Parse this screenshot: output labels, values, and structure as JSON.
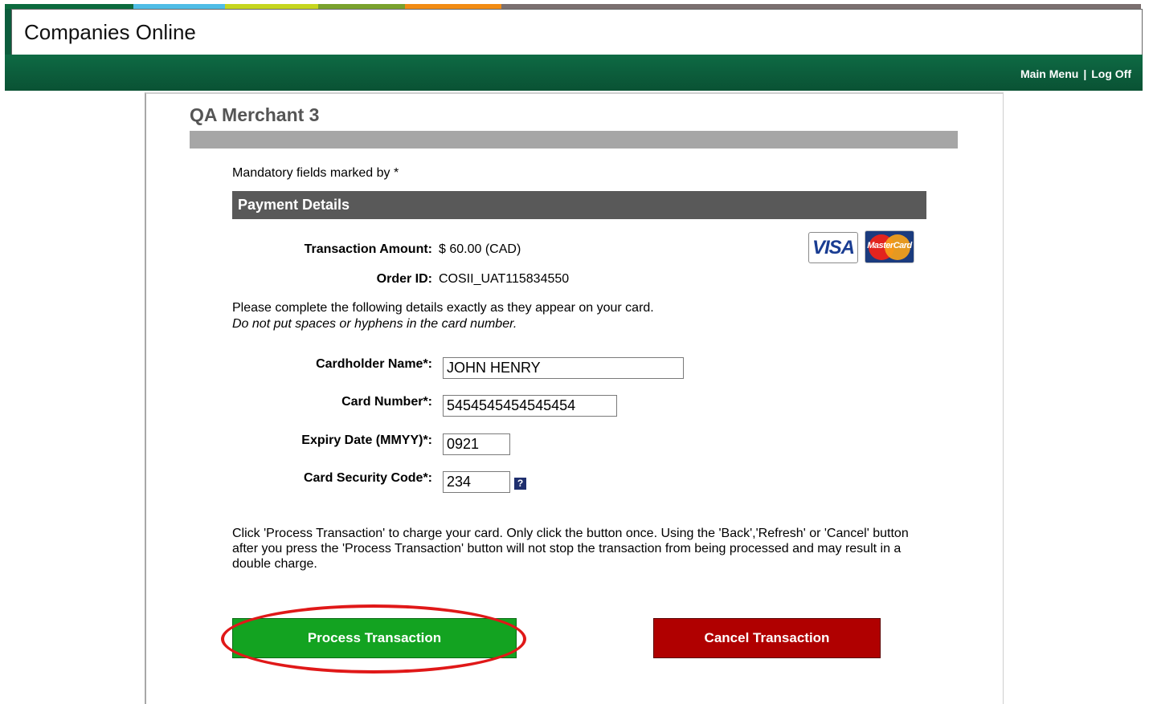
{
  "header": {
    "title": "Companies Online"
  },
  "nav": {
    "main_menu": "Main Menu",
    "separator": "|",
    "log_off": "Log Off"
  },
  "stripe_colors": [
    "#0c6b3e",
    "#4fbde6",
    "#c6d61f",
    "#7aa22d",
    "#f28c14",
    "#7b7070"
  ],
  "merchant": {
    "name": "QA Merchant 3"
  },
  "form": {
    "mandatory_note": "Mandatory fields marked by *",
    "section_title": "Payment Details",
    "transaction_amount_label": "Transaction Amount:",
    "transaction_amount_value": "$ 60.00 (CAD)",
    "order_id_label": "Order ID:",
    "order_id_value": "COSII_UAT115834550",
    "card_logos": {
      "visa": "VISA",
      "mastercard": "MasterCard"
    },
    "instructions": "Please complete the following details exactly as they appear on your card.",
    "instructions_italic": "Do not put spaces or hyphens in the card number.",
    "cardholder_name_label": "Cardholder Name*:",
    "cardholder_name_value": "JOHN HENRY",
    "card_number_label": "Card Number*:",
    "card_number_value": "5454545454545454",
    "expiry_label": "Expiry Date (MMYY)*:",
    "expiry_value": "0921",
    "security_code_label": "Card Security Code*:",
    "security_code_value": "234",
    "help_icon_glyph": "?",
    "notice": "Click 'Process Transaction' to charge your card. Only click the button once. Using the 'Back','Refresh' or 'Cancel' button after you press the 'Process Transaction' button will not stop the transaction from being processed and may result in a double charge."
  },
  "buttons": {
    "process": "Process Transaction",
    "cancel": "Cancel Transaction"
  }
}
